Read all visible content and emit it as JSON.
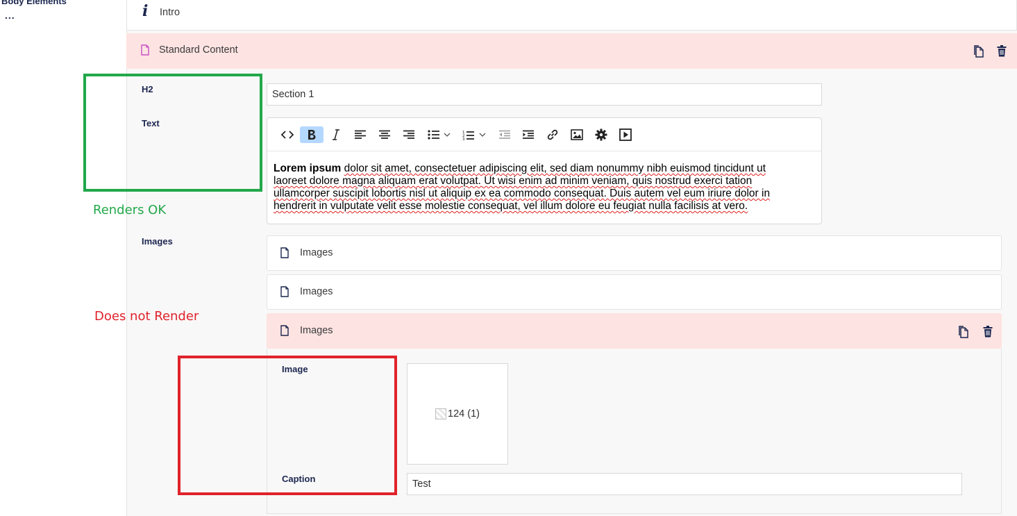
{
  "left_nav": {
    "label": "Body Elements",
    "more": "..."
  },
  "blocks": {
    "intro": {
      "label": "Intro",
      "icon": "info-icon"
    },
    "standard": {
      "label": "Standard Content",
      "icon": "document-icon",
      "actions": [
        "copy-icon",
        "delete-icon"
      ],
      "properties": {
        "h2": {
          "label": "H2",
          "value": "Section 1"
        },
        "text": {
          "label": "Text",
          "toolbar": [
            "code-icon",
            "bold-icon",
            "italic-icon",
            "align-left-icon",
            "align-center-icon",
            "align-right-icon",
            "bullet-list-icon",
            "chevron-down-icon",
            "numbered-list-icon",
            "chevron-down-icon",
            "outdent-icon",
            "indent-icon",
            "link-icon",
            "image-icon",
            "gear-icon",
            "media-icon"
          ],
          "bold_lead": "Lorem ipsum",
          "lines": [
            "dolor sit amet, consectetuer adipiscing elit, sed diam nonummy nibh euismod tincidunt ut",
            "laoreet dolore magna aliquam erat volutpat. Ut wisi enim ad minim veniam, quis nostrud exerci tation",
            "ullamcorper suscipit lobortis nisl ut aliquip ex ea commodo consequat. Duis autem vel eum iriure dolor in",
            "hendrerit in vulputate velit esse molestie consequat, vel illum dolore eu feugiat nulla facilisis at vero."
          ]
        },
        "images": {
          "label": "Images",
          "items": [
            {
              "label": "Images"
            },
            {
              "label": "Images"
            },
            {
              "label": "Images"
            }
          ],
          "expanded": {
            "image_label": "Image",
            "image_alt": "124 (1)",
            "caption_label": "Caption",
            "caption_value": "Test"
          }
        }
      }
    }
  },
  "annotations": {
    "ok": "Renders OK",
    "fail": "Does not Render",
    "ok_color": "#22a84a",
    "fail_color": "#e0222b"
  },
  "colors": {
    "active_block": "#fde3e1",
    "panel": "#f9f8f8",
    "text_dark": "#1b264f",
    "doc_icon_accent": "#c94fc9"
  }
}
